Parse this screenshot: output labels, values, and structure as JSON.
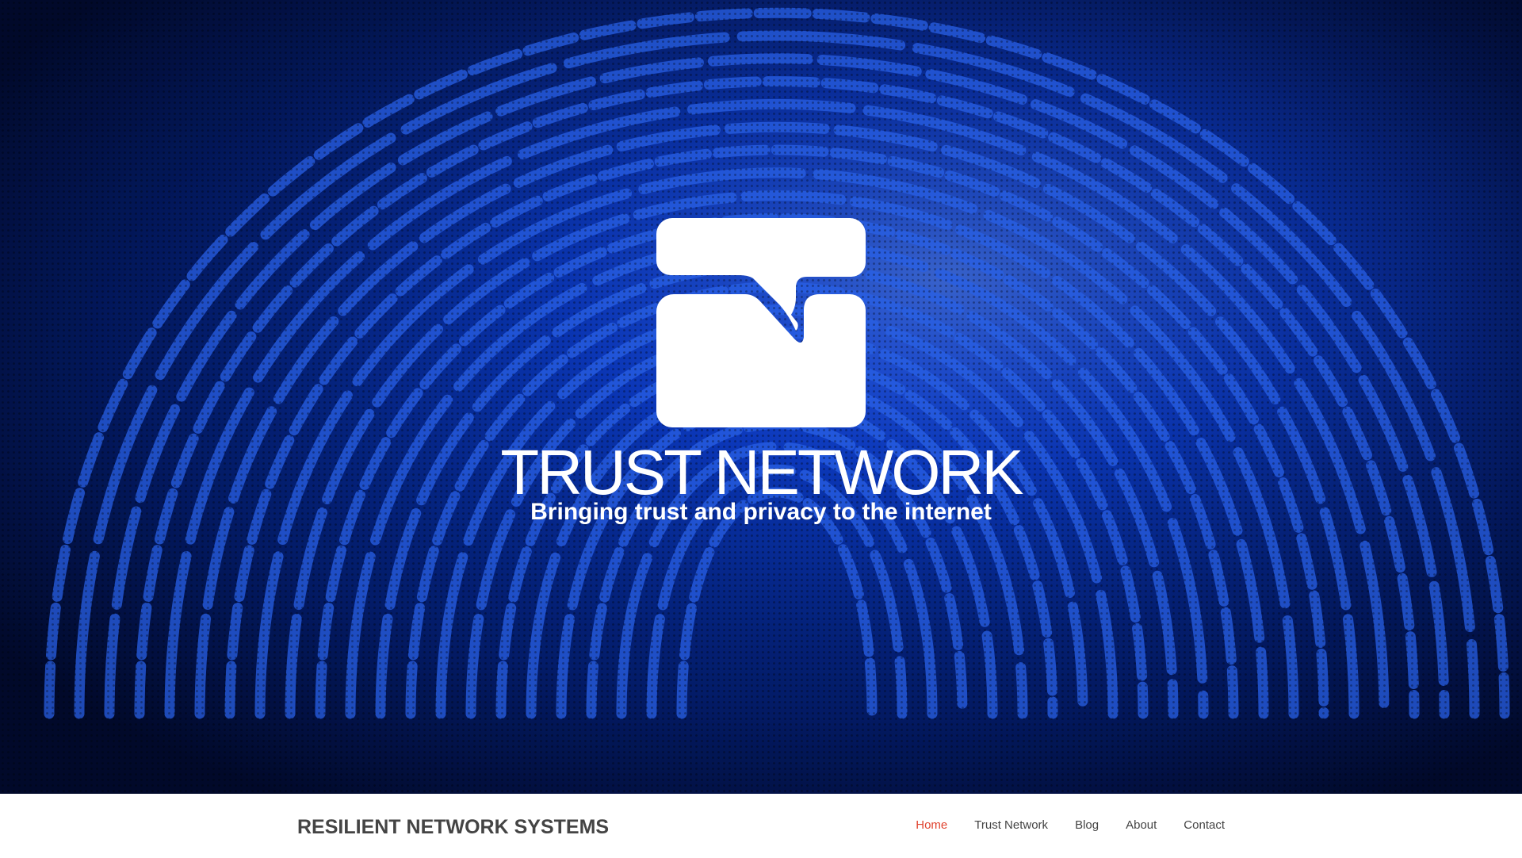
{
  "hero": {
    "title": "TRUST NETWORK",
    "tagline": "Bringing trust and privacy to the internet",
    "background_colors": {
      "deep": "#020a2b",
      "mid": "#041f73",
      "bright": "#0a3fd6",
      "ridge": "#2f6cff"
    }
  },
  "header": {
    "site_name": "RESILIENT NETWORK SYSTEMS",
    "nav": [
      {
        "label": "Home",
        "active": true
      },
      {
        "label": "Trust Network",
        "active": false
      },
      {
        "label": "Blog",
        "active": false
      },
      {
        "label": "About",
        "active": false
      },
      {
        "label": "Contact",
        "active": false
      }
    ],
    "active_color": "#e0432f",
    "text_color": "#444444"
  },
  "icons": {
    "logo": "trust-network-logo-icon"
  }
}
